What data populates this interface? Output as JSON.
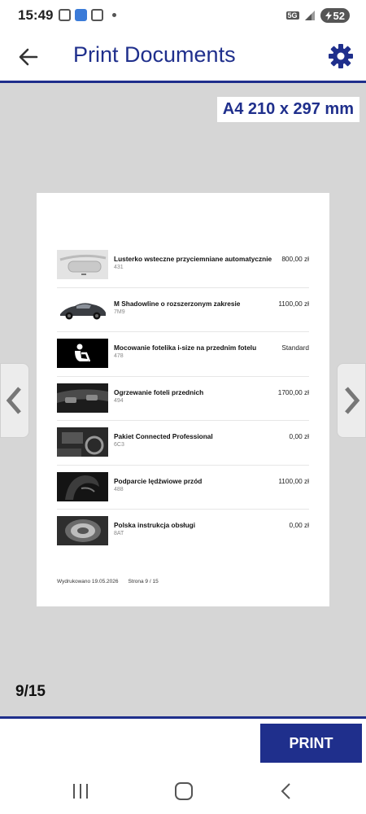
{
  "status_bar": {
    "time": "15:49",
    "network": "5G",
    "battery": "52"
  },
  "header": {
    "title": "Print Documents"
  },
  "paper_size": "A4 210 x 297 mm",
  "document": {
    "items": [
      {
        "name": "Lusterko wsteczne przyciemniane automatycznie",
        "code": "431",
        "price": "800,00 zł",
        "thumb_icon": "rear-mirror-image"
      },
      {
        "name": "M Shadowline o rozszerzonym zakresie",
        "code": "7M9",
        "price": "1100,00 zł",
        "thumb_icon": "car-image"
      },
      {
        "name": "Mocowanie fotelika i-size na przednim fotelu",
        "code": "478",
        "price": "Standard",
        "thumb_icon": "child-seat-icon"
      },
      {
        "name": "Ogrzewanie foteli przednich",
        "code": "494",
        "price": "1700,00 zł",
        "thumb_icon": "dashboard-image"
      },
      {
        "name": "Pakiet Connected Professional",
        "code": "6C3",
        "price": "0,00 zł",
        "thumb_icon": "interior-image"
      },
      {
        "name": "Podparcie lędźwiowe przód",
        "code": "488",
        "price": "1100,00 zł",
        "thumb_icon": "seat-image"
      },
      {
        "name": "Polska instrukcja obsługi",
        "code": "8AT",
        "price": "0,00 zł",
        "thumb_icon": "manual-image"
      }
    ],
    "footer_printed": "Wydrukowano 19.05.2026",
    "footer_page": "Strona 9 / 15"
  },
  "pager": {
    "counter": "9/15"
  },
  "actions": {
    "print_label": "PRINT"
  },
  "colors": {
    "accent": "#1f2f8c",
    "background": "#d6d6d6"
  }
}
